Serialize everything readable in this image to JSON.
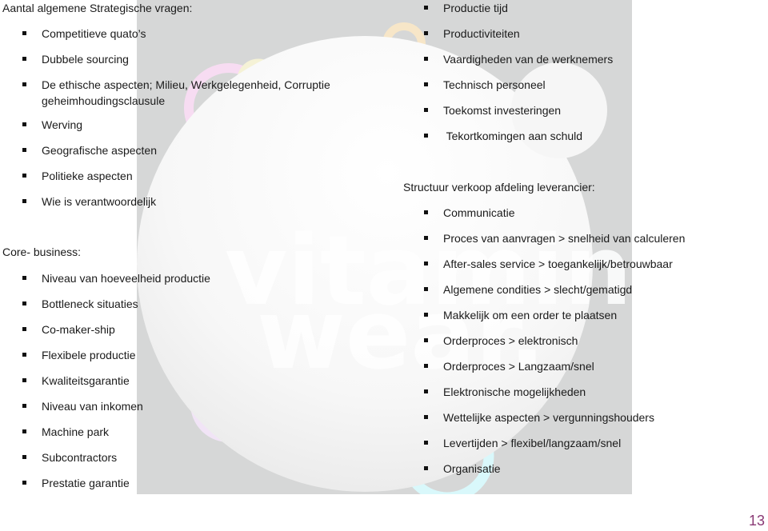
{
  "colors": {
    "panel_bg": "#d6d7d7",
    "page_number": "#8a3a75",
    "ring_pink": "#f7dcf2",
    "ring_yellow": "#f5f2d6",
    "ring_cyan": "#d9f8fb",
    "ring_orange": "#f7e6c8"
  },
  "background_logo": {
    "word1": "vitamin",
    "word2": "wear."
  },
  "left": {
    "section1": {
      "heading": "Aantal algemene Strategische vragen:",
      "items": [
        "Competitieve quato’s",
        "Dubbele sourcing",
        "De ethische aspecten; Milieu, Werkgelegenheid, Corruptie",
        "geheimhoudingsclausule",
        "Werving",
        "Geografische aspecten",
        "Politieke aspecten",
        "Wie is verantwoordelijk"
      ]
    },
    "section2": {
      "heading": "Core- business:",
      "items": [
        "Niveau van hoeveelheid productie",
        "Bottleneck situaties",
        "Co-maker-ship",
        "Flexibele productie",
        "Kwaliteitsgarantie",
        "Niveau van inkomen",
        "Machine park",
        "Subcontractors",
        "Prestatie garantie"
      ]
    }
  },
  "right": {
    "section1": {
      "items": [
        "Productie tijd",
        "Productiviteiten",
        "Vaardigheden van de werknemers",
        "Technisch personeel",
        "Toekomst investeringen",
        " Tekortkomingen aan schuld"
      ]
    },
    "section2": {
      "heading": "Structuur verkoop afdeling leverancier:",
      "items": [
        "Communicatie",
        "Proces van aanvragen > snelheid van calculeren",
        "After-sales service > toegankelijk/betrouwbaar",
        "Algemene condities > slecht/gematigd",
        "Makkelijk om een order te plaatsen",
        "Orderproces > elektronisch",
        "Orderproces > Langzaam/snel",
        "Elektronische mogelijkheden",
        "Wettelijke aspecten > vergunningshouders",
        "Levertijden > flexibel/langzaam/snel",
        "Organisatie"
      ]
    }
  },
  "page_number": "13"
}
